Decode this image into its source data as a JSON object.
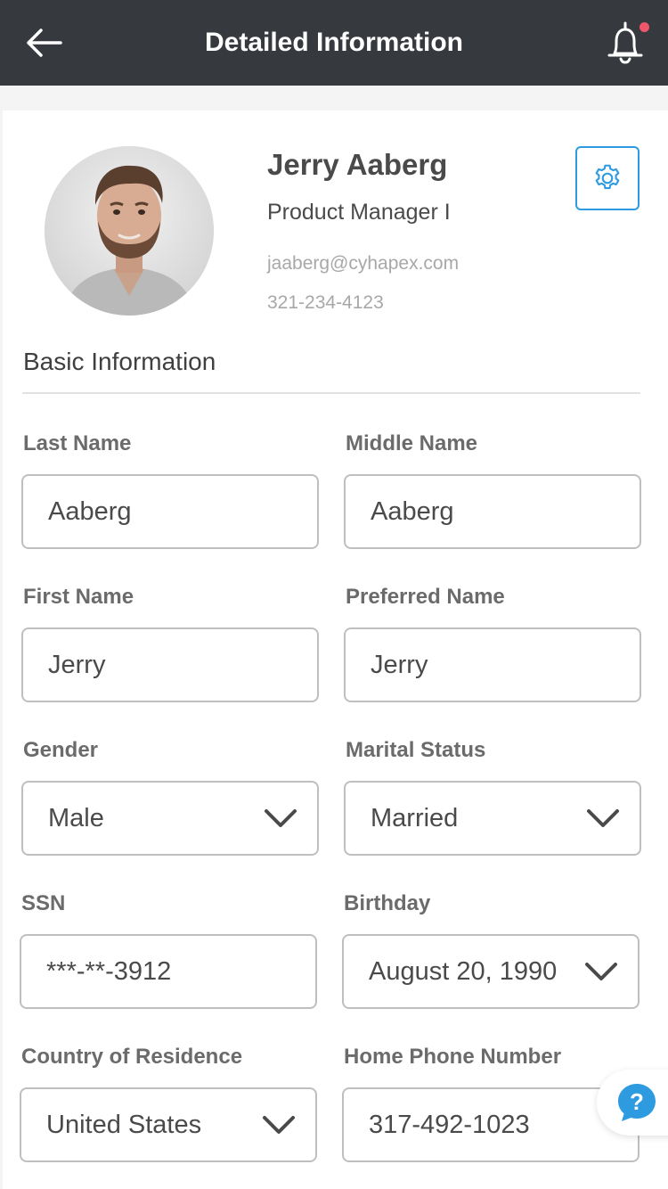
{
  "header": {
    "title": "Detailed Information",
    "back_icon": "arrow-left-icon",
    "notification_icon": "bell-icon",
    "notification_dot_color": "#f0566a",
    "background_color": "#363a3f"
  },
  "profile": {
    "name": "Jerry Aaberg",
    "role": "Product Manager I",
    "email": "jaaberg@cyhapex.com",
    "phone": "321-234-4123",
    "avatar_icon": "avatar-photo",
    "settings_icon": "gear-icon",
    "accent_color": "#2e9ae0"
  },
  "basic_info": {
    "section_title": "Basic Information",
    "fields": {
      "last_name": {
        "label": "Last Name",
        "value": "Aaberg"
      },
      "middle_name": {
        "label": "Middle Name",
        "value": "Aaberg"
      },
      "first_name": {
        "label": "First Name",
        "value": "Jerry"
      },
      "preferred_name": {
        "label": "Preferred Name",
        "value": "Jerry"
      },
      "gender": {
        "label": "Gender",
        "value": "Male"
      },
      "marital_status": {
        "label": "Marital Status",
        "value": "Married"
      },
      "ssn": {
        "label": "SSN",
        "value": "***-**-3912"
      },
      "birthday": {
        "label": "Birthday",
        "value": "August 20, 1990"
      },
      "country": {
        "label": "Country of Residence",
        "value": "United States"
      },
      "home_phone": {
        "label": "Home Phone Number",
        "value": "317-492-1023"
      }
    }
  },
  "help": {
    "icon": "question-chat-icon",
    "color": "#2e9ae0"
  }
}
